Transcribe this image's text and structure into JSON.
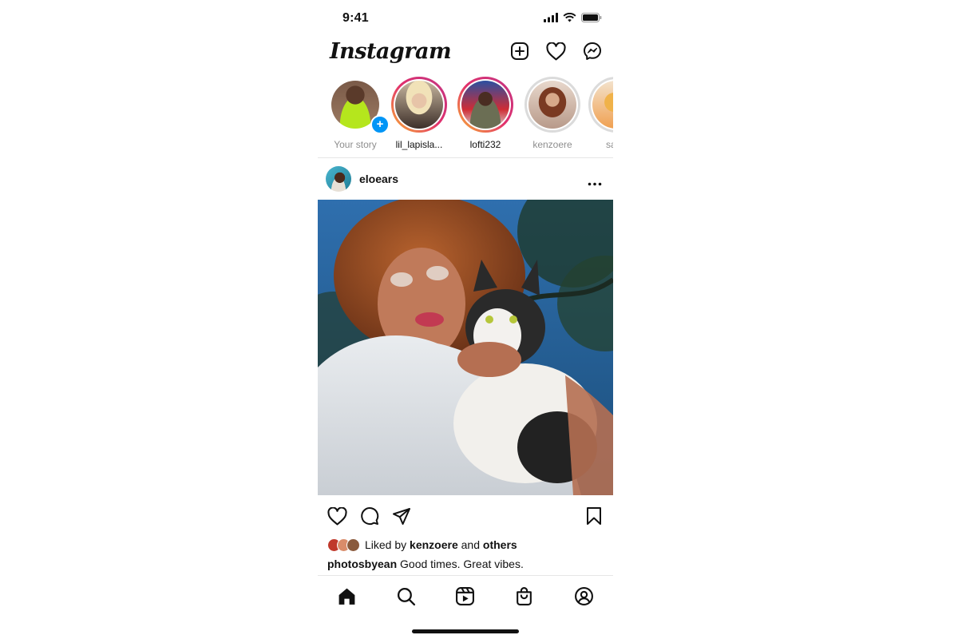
{
  "status_bar": {
    "time": "9:41"
  },
  "header": {
    "brand": "Instagram"
  },
  "stories": [
    {
      "label": "Your story",
      "own": true
    },
    {
      "label": "lil_lapisla...",
      "ring": "unseen"
    },
    {
      "label": "lofti232",
      "ring": "unseen"
    },
    {
      "label": "kenzoere",
      "ring": "seen"
    },
    {
      "label": "sapp",
      "ring": "seen"
    }
  ],
  "post": {
    "username": "eloears",
    "liked_by_prefix": "Liked by",
    "liked_by_user": "kenzoere",
    "liked_by_and": "and",
    "liked_by_others": "others",
    "caption_user": "photosbyean",
    "caption_text": "Good times. Great vibes."
  },
  "colors": {
    "accent_blue": "#0095f6",
    "story_gradient": [
      "#f9b233",
      "#e1306c",
      "#c13584"
    ],
    "text": "#111111",
    "muted": "#8e8e8e"
  },
  "icons": {
    "header": [
      "new-post-icon",
      "heart-icon",
      "messenger-icon"
    ],
    "post_actions": [
      "like-icon",
      "comment-icon",
      "share-icon",
      "bookmark-icon"
    ],
    "tabs": [
      "home-icon",
      "search-icon",
      "reels-icon",
      "shop-icon",
      "profile-icon"
    ]
  }
}
